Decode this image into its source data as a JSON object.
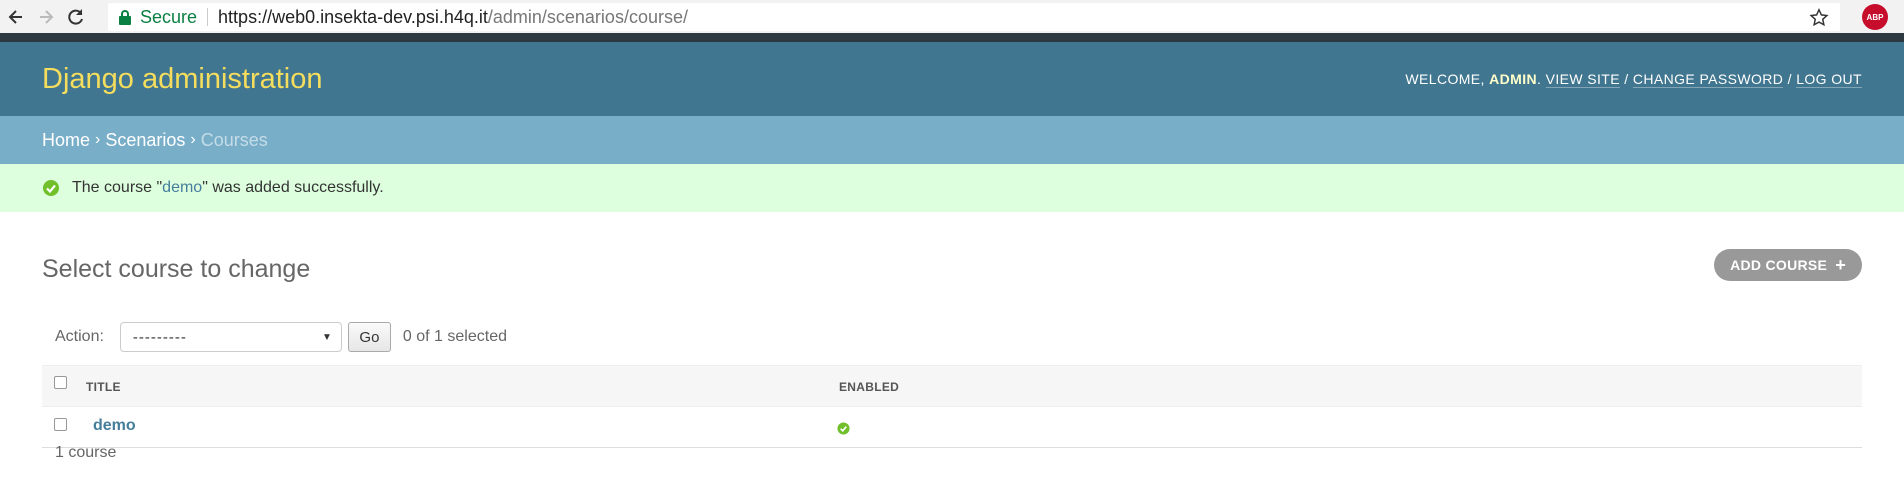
{
  "browser": {
    "secure_label": "Secure",
    "url_host": "https://web0.insekta-dev.psi.h4q.it",
    "url_path": "/admin/scenarios/course/",
    "extension_label": "ABP"
  },
  "header": {
    "brand": "Django administration",
    "welcome": "WELCOME, ",
    "username": "ADMIN",
    "view_site": "VIEW SITE",
    "change_password": "CHANGE PASSWORD",
    "log_out": "LOG OUT",
    "sep": " / "
  },
  "breadcrumbs": {
    "home": "Home",
    "app": "Scenarios",
    "current": "Courses",
    "sep": "›"
  },
  "message": {
    "prefix": "The course \"",
    "link": "demo",
    "suffix": "\" was added successfully."
  },
  "content": {
    "title": "Select course to change",
    "add_button": "ADD COURSE",
    "action_label": "Action:",
    "action_selected": "---------",
    "go_button": "Go",
    "selected_count": "0 of 1 selected",
    "columns": [
      "TITLE",
      "ENABLED"
    ],
    "rows": [
      {
        "title": "demo",
        "enabled": true
      }
    ],
    "paginator": "1 course"
  },
  "colors": {
    "header_bg": "#417690",
    "brand": "#f5dd5d",
    "breadcrumbs_bg": "#79aec8",
    "success_bg": "#ddffdd",
    "link": "#447e9b",
    "success_icon": "#70bf2b"
  }
}
